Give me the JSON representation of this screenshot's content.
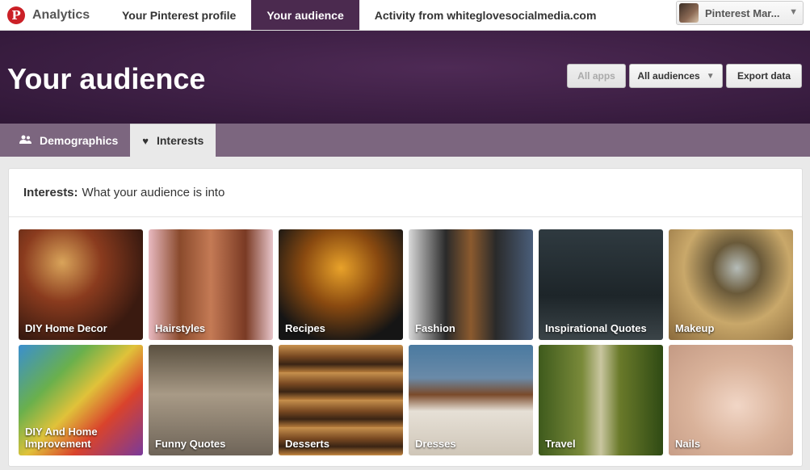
{
  "nav": {
    "brand": "Analytics",
    "tabs": [
      {
        "label": "Your Pinterest profile"
      },
      {
        "label": "Your audience"
      },
      {
        "label": "Activity from whiteglovesocialmedia.com"
      }
    ],
    "account_name": "Pinterest Mar..."
  },
  "hero": {
    "title": "Your audience",
    "buttons": {
      "all_apps": "All apps",
      "all_audiences": "All audiences",
      "export": "Export data"
    }
  },
  "subnav": {
    "demographics": "Demographics",
    "interests": "Interests"
  },
  "panel": {
    "heading_bold": "Interests:",
    "heading_text": "What your audience is into"
  },
  "interests": [
    {
      "label": "DIY Home Decor"
    },
    {
      "label": "Hairstyles"
    },
    {
      "label": "Recipes"
    },
    {
      "label": "Fashion"
    },
    {
      "label": "Inspirational Quotes"
    },
    {
      "label": "Makeup"
    },
    {
      "label": "DIY And Home Improvement"
    },
    {
      "label": "Funny Quotes"
    },
    {
      "label": "Desserts"
    },
    {
      "label": "Dresses"
    },
    {
      "label": "Travel"
    },
    {
      "label": "Nails"
    }
  ],
  "colors": {
    "brand_red": "#cb2027",
    "active_tab": "#4b2a4f",
    "subnav": "#7c667f"
  }
}
